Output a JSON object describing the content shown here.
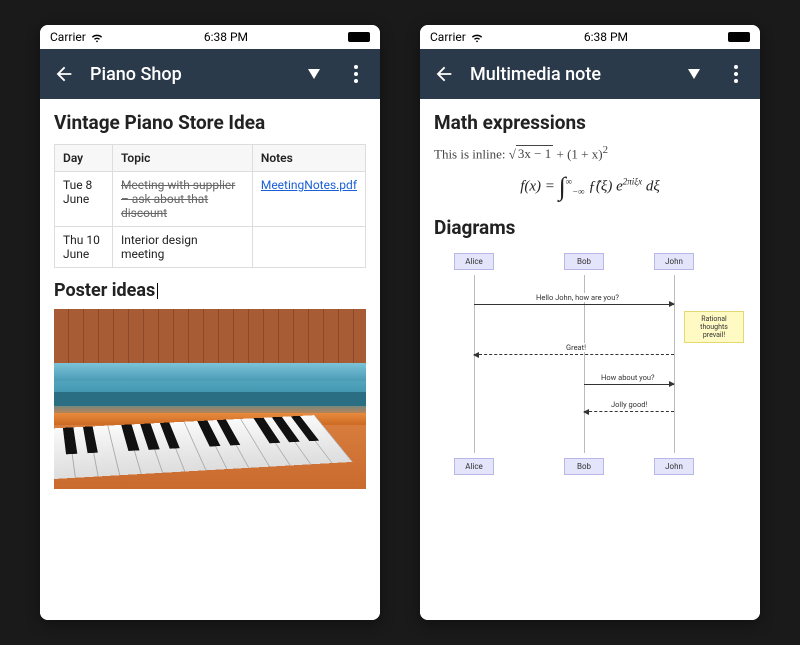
{
  "status": {
    "carrier": "Carrier",
    "time": "6:38 PM"
  },
  "left": {
    "title": "Piano Shop",
    "heading": "Vintage Piano Store Idea",
    "table": {
      "headers": [
        "Day",
        "Topic",
        "Notes"
      ],
      "rows": [
        {
          "day": "Tue 8 June",
          "topic_struck": "Meeting with supplier – ask about that discount",
          "notes_link": "MeetingNotes.pdf"
        },
        {
          "day": "Thu 10 June",
          "topic": "Interior design meeting",
          "notes": ""
        }
      ]
    },
    "subheading": "Poster ideas"
  },
  "right": {
    "title": "Multimedia note",
    "heading1": "Math expressions",
    "inline_prefix": "This is inline: ",
    "inline_math_under_sqrt": "3x − 1",
    "inline_math_rest": " + (1 + x)",
    "inline_math_exp": "2",
    "block_math": {
      "lhs": "f(x) = ",
      "int_lower": "−∞",
      "int_upper": "∞",
      "body1": " ƒ̂(ξ) e",
      "exp": "2πiξx",
      "body2": " dξ"
    },
    "heading2": "Diagrams",
    "diagram": {
      "actors": [
        "Alice",
        "Bob",
        "John"
      ],
      "msg1": "Hello John, how are you?",
      "note": "Rational thoughts prevail!",
      "msg2": "Great!",
      "msg3": "How about you?",
      "msg4": "Jolly good!"
    }
  }
}
